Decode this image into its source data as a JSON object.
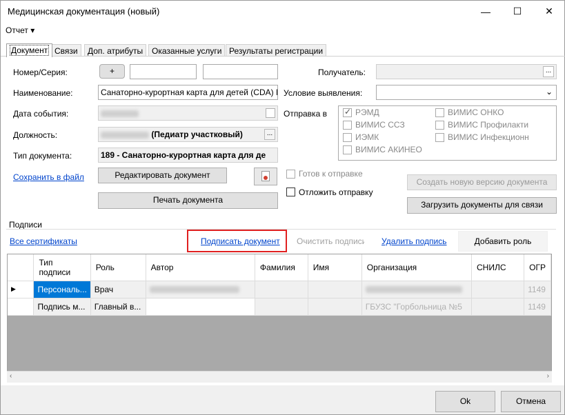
{
  "window": {
    "title": "Медицинская документация (новый)",
    "minimize": "—",
    "maximize": "☐",
    "close": "✕"
  },
  "menu": {
    "report": "Отчет ▾"
  },
  "tabs": [
    "Документ",
    "Связи",
    "Доп. атрибуты",
    "Оказанные услуги",
    "Результаты регистрации"
  ],
  "form": {
    "number_label": "Номер/Серия:",
    "plus_label": "+",
    "name_label": "Наименование:",
    "name_value": "Санаторно-курортная карта для детей (CDA) Р",
    "event_date_label": "Дата события:",
    "position_label": "Должность:",
    "position_value": "(Педиатр участковый)",
    "doc_type_label": "Тип документа:",
    "doc_type_value": "189 - Санаторно-курортная карта для де",
    "save_to_file": "Сохранить в файл",
    "edit_doc_button": "Редактировать документ",
    "print_doc_button": "Печать документа",
    "recipient_label": "Получатель:",
    "condition_label": "Условие выявления:",
    "send_to_label": "Отправка в",
    "send_targets": [
      {
        "label": "РЭМД",
        "checked": true
      },
      {
        "label": "ВИМИС ОНКО",
        "checked": false
      },
      {
        "label": "ВИМИС ССЗ",
        "checked": false
      },
      {
        "label": "ВИМИС Профилакти",
        "checked": false
      },
      {
        "label": "ИЭМК",
        "checked": false
      },
      {
        "label": "ВИМИС Инфекционн",
        "checked": false
      },
      {
        "label": "ВИМИС АКИНЕО",
        "checked": false
      }
    ],
    "ready_to_send": "Готов к отправке",
    "postpone_send": "Отложить отправку",
    "new_version_button": "Создать новую версию документа",
    "load_docs_button": "Загрузить документы для связи"
  },
  "signatures": {
    "section_label": "Подписи",
    "all_certs": "Все сертификаты",
    "sign_doc": "Подписать документ",
    "clear_sig": "Очистить подписи",
    "delete_sig": "Удалить подпись",
    "add_role": "Добавить роль",
    "columns": [
      "Тип подписи",
      "Роль",
      "Автор",
      "Фамилия",
      "Имя",
      "Организация",
      "СНИЛС",
      "ОГР"
    ],
    "rows": [
      {
        "marker": "▶",
        "type": "Персональ...",
        "role": "Врач",
        "org": "",
        "ogr": "1149"
      },
      {
        "marker": "",
        "type": "Подпись м...",
        "role": "Главный в...",
        "org": "ГБУЗС \"Горбольница №5",
        "ogr": "1149"
      }
    ]
  },
  "footer": {
    "ok": "Ok",
    "cancel": "Отмена"
  }
}
